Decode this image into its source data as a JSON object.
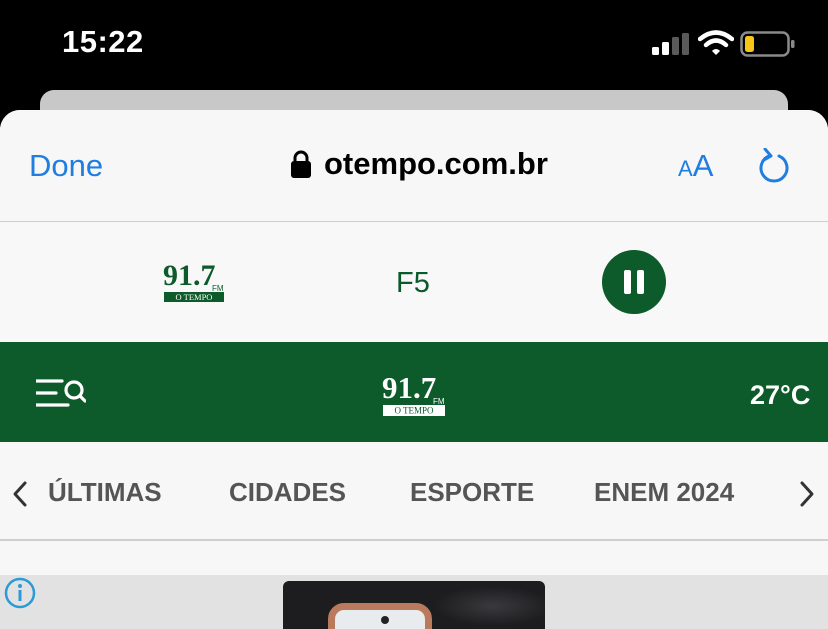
{
  "status_bar": {
    "time": "15:22",
    "signal_icon": "cellular-signal-icon",
    "wifi_icon": "wifi-icon",
    "battery_icon": "battery-low-icon",
    "battery_color": "#f5c518"
  },
  "browser_bar": {
    "done_label": "Done",
    "url": "otempo.com.br",
    "lock_icon": "lock-icon",
    "text_size_small": "A",
    "text_size_big": "A",
    "reload_icon": "reload-icon",
    "accent_color": "#1f7ee0"
  },
  "radio_player": {
    "logo_number": "91.7",
    "logo_fm": "FM",
    "logo_brand": "O TEMPO",
    "title": "F5",
    "pause_icon": "pause-icon",
    "brand_color": "#0d5a2b"
  },
  "site_header": {
    "menu_icon": "menu-search-icon",
    "logo_number": "91.7",
    "logo_fm": "FM",
    "logo_brand": "O TEMPO",
    "temperature": "27°C"
  },
  "category_nav": {
    "prev_icon": "chevron-left-icon",
    "next_icon": "chevron-right-icon",
    "items": [
      "ÚLTIMAS",
      "CIDADES",
      "ESPORTE",
      "ENEM 2024"
    ]
  },
  "content": {
    "info_icon": "info-icon"
  }
}
